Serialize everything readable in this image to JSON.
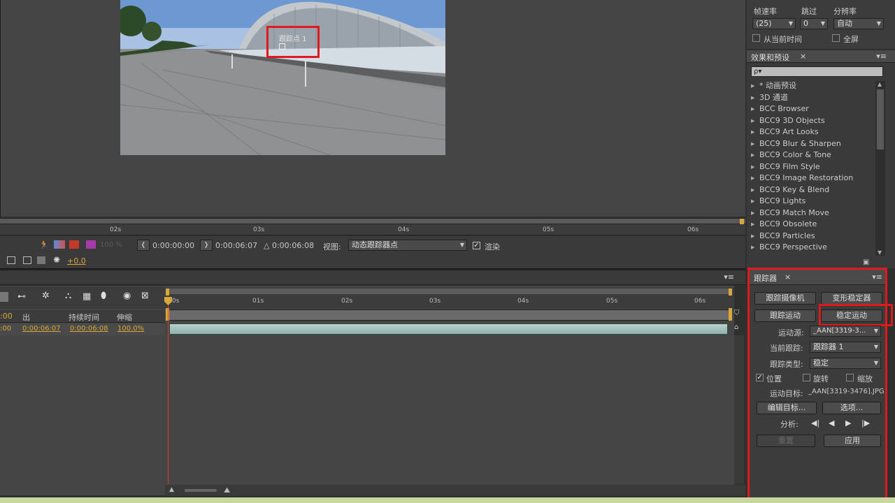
{
  "viewer": {
    "tracker_label": "跟踪点 1",
    "time_ticks": [
      "02s",
      "03s",
      "04s",
      "05s",
      "06s"
    ],
    "zoom": "100 %",
    "in_time": "0:00:00:00",
    "out_time": "0:00:06:07",
    "duration_time": "△ 0:00:06:08",
    "view_label": "视图:",
    "view_value": "动态跟踪器点",
    "render_label": "渲染",
    "exposure": "+0.0"
  },
  "timeline": {
    "ticks": [
      "0s",
      "01s",
      "02s",
      "03s",
      "04s",
      "05s",
      "06s"
    ],
    "col_in": ":00",
    "col_out": "出",
    "col_duration": "持续时间",
    "col_stretch": "伸缩",
    "row_out": "0:00:06:07",
    "row_duration": "0:00:06:08",
    "row_stretch": "100.0%"
  },
  "preview": {
    "fps_label": "帧速率",
    "skip_label": "跳过",
    "res_label": "分辨率",
    "fps_value": "(25)",
    "skip_value": "0",
    "res_value": "自动",
    "from_current": "从当前时间",
    "fullscreen": "全屏"
  },
  "effects": {
    "tab": "效果和预设",
    "search_placeholder": "ρ▾",
    "items": [
      "* 动画预设",
      "3D 通道",
      "BCC Browser",
      "BCC9 3D Objects",
      "BCC9 Art Looks",
      "BCC9 Blur & Sharpen",
      "BCC9 Color & Tone",
      "BCC9 Film Style",
      "BCC9 Image Restoration",
      "BCC9 Key & Blend",
      "BCC9 Lights",
      "BCC9 Match Move",
      "BCC9 Obsolete",
      "BCC9 Particles",
      "BCC9 Perspective"
    ]
  },
  "tracker": {
    "tab": "跟踪器",
    "track_camera": "跟踪摄像机",
    "warp_stabilizer": "变形稳定器",
    "track_motion": "跟踪运动",
    "stabilize_motion": "稳定运动",
    "motion_source_label": "运动源:",
    "motion_source_value": "_AAN[3319-3...",
    "current_track_label": "当前跟踪:",
    "current_track_value": "跟踪器 1",
    "track_type_label": "跟踪类型:",
    "track_type_value": "稳定",
    "position": "位置",
    "rotation": "旋转",
    "scale": "缩放",
    "motion_target_label": "运动目标:",
    "motion_target_value": "_AAN[3319-3476].JPG",
    "edit_target": "编辑目标...",
    "options": "选项...",
    "analyze_label": "分析:",
    "reset": "重置",
    "apply": "应用"
  }
}
